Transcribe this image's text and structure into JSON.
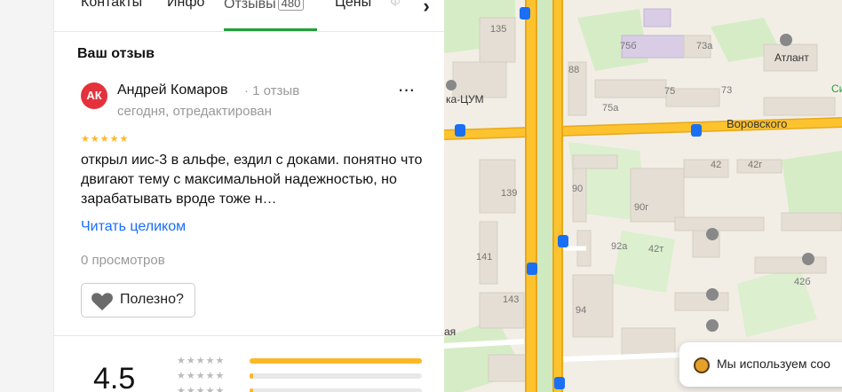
{
  "tabs": [
    {
      "label": "Контакты"
    },
    {
      "label": "Инфо"
    },
    {
      "label": "Отзывы",
      "count": "480",
      "active": true
    },
    {
      "label": "Цены"
    },
    {
      "label": "Ф"
    }
  ],
  "review": {
    "section_title": "Ваш отзыв",
    "avatar_initials": "АК",
    "author": "Андрей Комаров",
    "author_reviews": "· 1 отзыв",
    "time": "сегодня, отредактирован",
    "stars": "★★★★★",
    "text": "открыл иис-3 в альфе, ездил с доками. понятно что двигают тему с максимальной надежностью, но зарабатывать вроде тоже н…",
    "read_more": "Читать целиком",
    "views": "0 просмотров",
    "helpful": "Полезно?",
    "more_icon": "···"
  },
  "rating": {
    "value": "4.5",
    "distribution": [
      {
        "stars": "★★★★★",
        "fraction": 1.0
      },
      {
        "stars": "★★★★★",
        "fraction": 0.02
      },
      {
        "stars": "★★★★★",
        "fraction": 0.02
      }
    ]
  },
  "map": {
    "street": "Воровского",
    "numbers": [
      "135",
      "75б",
      "73а",
      "88",
      "75",
      "73",
      "75а",
      "139",
      "90",
      "90г",
      "42",
      "42г",
      "92а",
      "42т",
      "141",
      "143",
      "94",
      "42б"
    ],
    "pois": [
      "Атлант",
      "ка-ЦУМ",
      "Си",
      "ая"
    ],
    "colors": {
      "road": "#fcc32f",
      "road_edge": "#e8a81b",
      "green": "#cfe9c0",
      "building": "#e3ddd3"
    }
  },
  "cookie_text": "Мы используем coo"
}
